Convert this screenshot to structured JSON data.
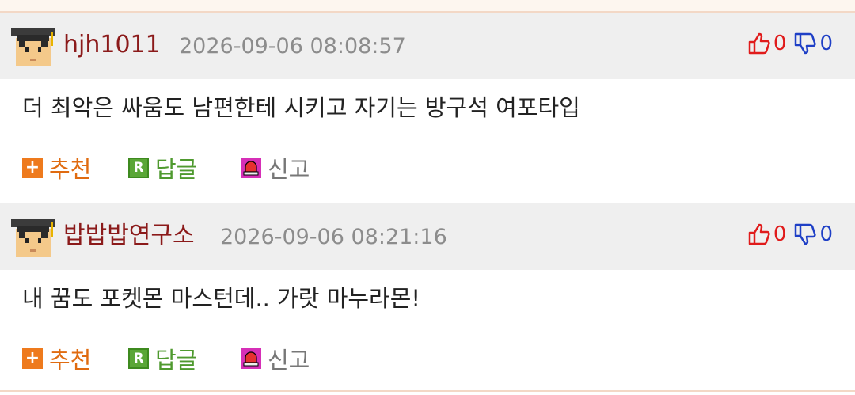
{
  "comments": [
    {
      "nickname": "hjh1011",
      "datetime": "2026-09-06 08:08:57",
      "upvotes": "0",
      "downvotes": "0",
      "text": "더 최악은 싸움도 남편한테 시키고 자기는 방구석 여포타입",
      "recommend_label": "추천",
      "reply_label": "답글",
      "report_label": "신고",
      "reply_icon_letter": "R"
    },
    {
      "nickname": "밥밥밥연구소",
      "datetime": "2026-09-06 08:21:16",
      "upvotes": "0",
      "downvotes": "0",
      "text": "내 꿈도 포켓몬 마스턴데.. 가랏 마누라몬!",
      "recommend_label": "추천",
      "reply_label": "답글",
      "report_label": "신고",
      "reply_icon_letter": "R"
    }
  ],
  "colors": {
    "nickname": "#8b1a1a",
    "upvote": "#e01b1b",
    "downvote": "#1e3fc6",
    "recommend": "#e06b10",
    "reply": "#4f9a2f",
    "report": "#777777"
  },
  "icons": {
    "avatar": "graduate-avatar-icon",
    "upvote": "thumbs-up-icon",
    "downvote": "thumbs-down-icon",
    "recommend": "plus-icon",
    "reply": "reply-r-icon",
    "report": "siren-icon"
  }
}
